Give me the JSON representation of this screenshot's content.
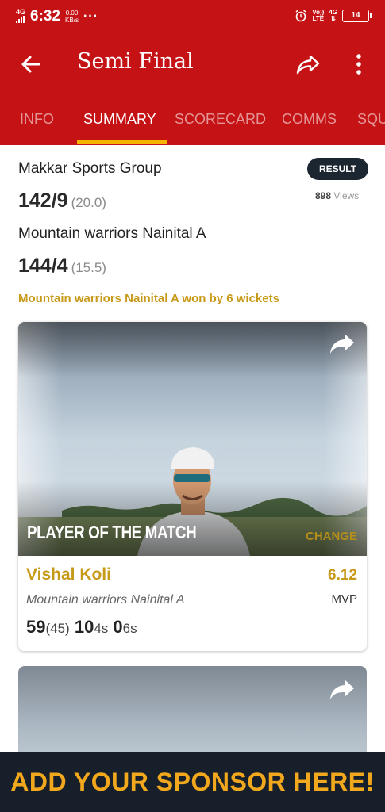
{
  "status_bar": {
    "network": "4G",
    "time": "6:32",
    "speed_value": "0.00",
    "speed_unit": "KB/s",
    "more": "···",
    "volte_top": "Vo))",
    "volte_bottom": "LTE",
    "net2": "4G",
    "battery": "14"
  },
  "app_bar": {
    "title": "Semi Final",
    "back_icon": "arrow-left-icon",
    "share_icon": "share-icon",
    "more_icon": "more-vertical-icon"
  },
  "tabs": [
    {
      "label": "INFO",
      "active": false
    },
    {
      "label": "SUMMARY",
      "active": true
    },
    {
      "label": "SCORECARD",
      "active": false
    },
    {
      "label": "COMMS",
      "active": false
    },
    {
      "label": "SQU",
      "active": false
    }
  ],
  "summary": {
    "team1": "Makkar Sports Group",
    "team1_score": "142/9",
    "team1_overs": "(20.0)",
    "team2": "Mountain warriors Nainital A",
    "team2_score": "144/4",
    "team2_overs": "(15.5)",
    "badge": "RESULT",
    "views_count": "898",
    "views_label": "Views",
    "result": "Mountain warriors Nainital A won by 6 wickets"
  },
  "player_card": {
    "heading": "PLAYER OF THE MATCH",
    "change": "CHANGE",
    "name": "Vishal Koli",
    "team": "Mountain warriors Nainital A",
    "mvp_value": "6.12",
    "mvp_label": "MVP",
    "runs": "59",
    "balls": "(45)",
    "fours": "10",
    "fours_label": "4s",
    "sixes": "0",
    "sixes_label": "6s"
  },
  "sponsor": {
    "text": "ADD YOUR SPONSOR HERE!"
  },
  "colors": {
    "brand_red": "#c41215",
    "accent_gold": "#c79a1a",
    "tab_underline": "#f5b400",
    "sponsor_bg": "#17202a"
  }
}
